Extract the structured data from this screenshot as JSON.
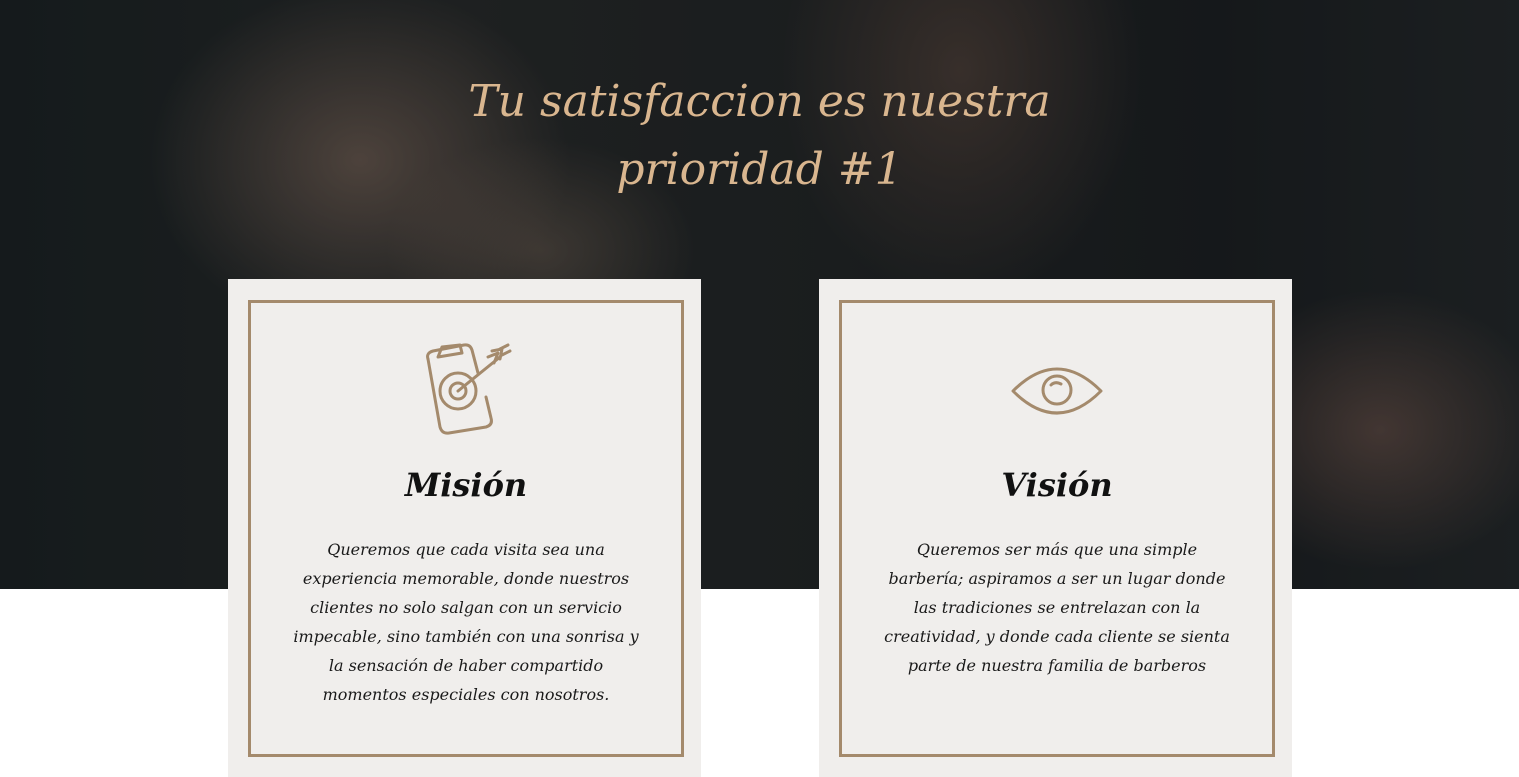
{
  "hero": {
    "title_line1": "Tu satisfaccion es nuestra",
    "title_line2": "prioridad #1"
  },
  "cards": [
    {
      "title": "Misión",
      "icon": "target-dart-icon",
      "text": "Queremos que cada visita sea una experiencia memorable, donde nuestros clientes no solo salgan con un servicio impecable, sino también con una sonrisa y la sensación de haber compartido momentos especiales con nosotros."
    },
    {
      "title": "Visión",
      "icon": "eye-icon",
      "text": "Queremos ser más que una simple barbería; aspiramos a ser un lugar donde las tradiciones se entrelazan con la creatividad, y donde cada cliente se sienta parte de nuestra familia de barberos"
    }
  ],
  "colors": {
    "accent": "#a48a6c",
    "title": "#d9b68f",
    "card_bg": "#f0eeec"
  }
}
